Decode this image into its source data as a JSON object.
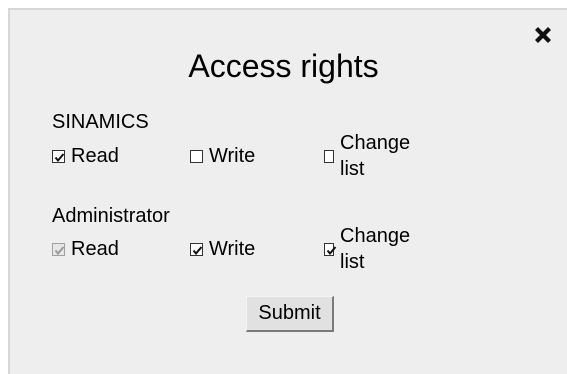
{
  "dialog": {
    "title": "Access rights",
    "close_icon": "close-icon",
    "groups": [
      {
        "label": "SINAMICS",
        "options": [
          {
            "label": "Read",
            "checked": true,
            "disabled": false
          },
          {
            "label": "Write",
            "checked": false,
            "disabled": false
          },
          {
            "label": "Change list",
            "checked": false,
            "disabled": false
          }
        ]
      },
      {
        "label": "Administrator",
        "options": [
          {
            "label": "Read",
            "checked": true,
            "disabled": true
          },
          {
            "label": "Write",
            "checked": true,
            "disabled": false
          },
          {
            "label": "Change list",
            "checked": true,
            "disabled": false
          }
        ]
      }
    ],
    "submit_label": "Submit"
  }
}
